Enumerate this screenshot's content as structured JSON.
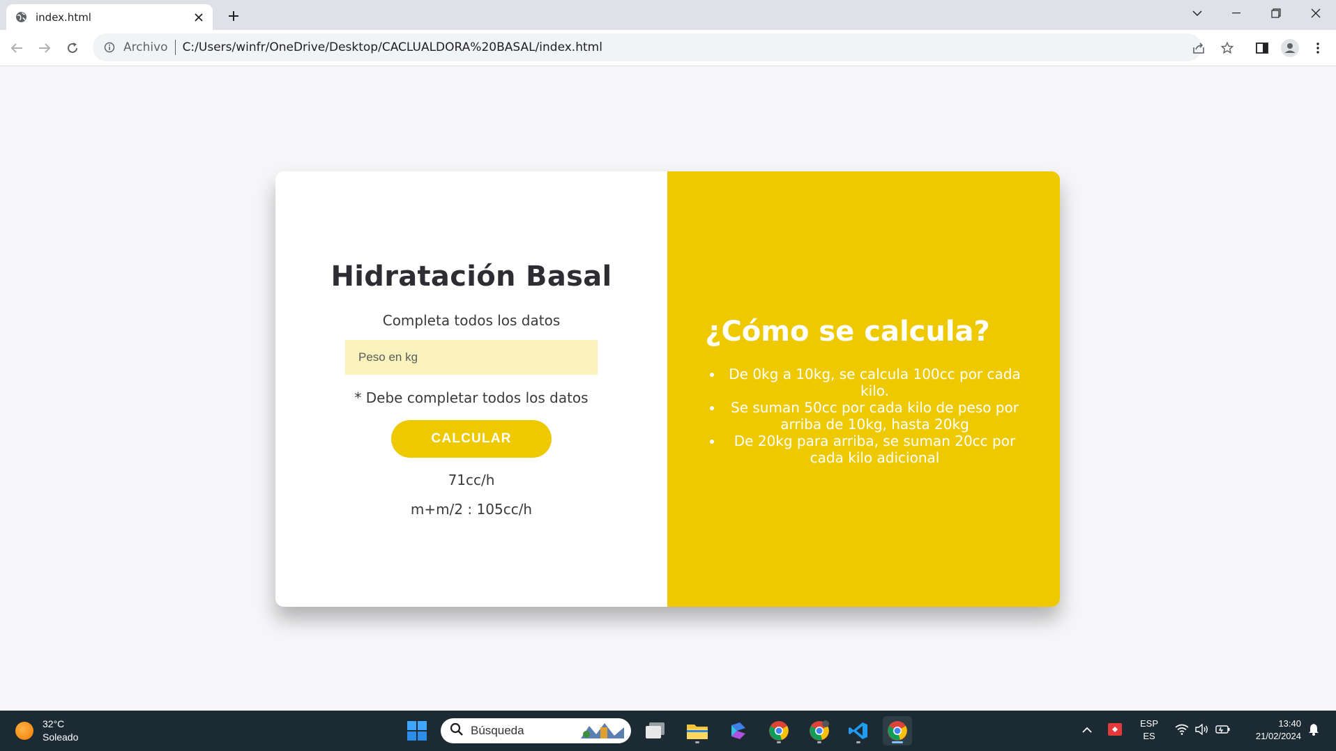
{
  "browser": {
    "tab_title": "index.html",
    "scheme_label": "Archivo",
    "url": "C:/Users/winfr/OneDrive/Desktop/CACLUALDORA%20BASAL/index.html"
  },
  "calculator": {
    "title": "Hidratación Basal",
    "subtitle": "Completa todos los datos",
    "weight_placeholder": "Peso en kg",
    "error_message": "* Debe completar todos los datos",
    "button_label": "CALCULAR",
    "result_hourly": "71cc/h",
    "result_mm2": "m+m/2 : 105cc/h"
  },
  "info": {
    "title": "¿Cómo se calcula?",
    "rules": [
      "De 0kg a 10kg, se calcula 100cc por cada kilo.",
      "Se suman 50cc por cada kilo de peso por arriba de 10kg, hasta 20kg",
      "De 20kg para arriba, se suman 20cc por cada kilo adicional"
    ]
  },
  "taskbar": {
    "temperature": "32°C",
    "weather": "Soleado",
    "search_placeholder": "Búsqueda",
    "language_top": "ESP",
    "language_bottom": "ES",
    "time": "13:40",
    "date": "21/02/2024"
  },
  "colors": {
    "accent": "#efc900",
    "input_bg": "#faf2bc",
    "text": "#2d2d33",
    "taskbar": "#1c2a33"
  }
}
